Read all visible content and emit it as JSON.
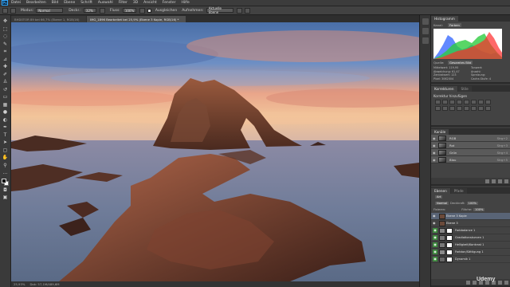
{
  "app": {
    "logo": "Ps"
  },
  "menu": [
    "Datei",
    "Bearbeiten",
    "Bild",
    "Ebene",
    "Schrift",
    "Auswahl",
    "Filter",
    "3D",
    "Ansicht",
    "Fenster",
    "Hilfe"
  ],
  "options": {
    "modus_label": "Modus:",
    "modus_value": "Normal",
    "deckr_label": "Deckr.:",
    "deckr_value": "32%",
    "fluss_label": "Fluss:",
    "fluss_value": "100%",
    "ausgleichen_label": "Ausgleichen",
    "aufnehmen_label": "Aufnehmen:",
    "aufnehmen_value": "Aktuelle Ebene"
  },
  "tabs": [
    {
      "label": "BHD0TOR 89 bei 66,7% (Ebene 1, RGB/16)",
      "active": false
    },
    {
      "label": "IMG_1896 Bearbeitet bei 25,9% (Ebene 3 Kopie, RGB/16) *",
      "active": true
    }
  ],
  "status": {
    "zoom": "25,93%",
    "doc": "Dok: 57,1M/489,6M"
  },
  "histogram": {
    "tab": "Histogramm",
    "kanal_label": "Kanal:",
    "kanal_value": "Farben",
    "quelle_label": "Quelle:",
    "quelle_value": "Gesamtes Bild",
    "stats": [
      "Mittelwert: 119,95",
      "Tonwert:",
      "Abweichung: 61,47",
      "Anzahl:",
      "Zentralwert: 123",
      "Spreizung:",
      "Pixel: 3062004",
      "Cache-Stufe: 4"
    ],
    "colors": {
      "red": "#ff2a2a",
      "green": "#2ecc40",
      "blue": "#3b6cff"
    }
  },
  "adjustments": {
    "tabs": [
      "Korrekturen",
      "Stile"
    ],
    "title": "Korrektur hinzufügen"
  },
  "channels": {
    "tab": "Kanäle",
    "rows": [
      {
        "name": "RGB",
        "key": "Strg+2"
      },
      {
        "name": "Rot",
        "key": "Strg+3"
      },
      {
        "name": "Grün",
        "key": "Strg+4"
      },
      {
        "name": "Blau",
        "key": "Strg+5"
      }
    ]
  },
  "layers": {
    "tabs": [
      "Ebenen",
      "Pfade"
    ],
    "kind_label": "Art",
    "mode_value": "Normal",
    "opacity_label": "Deckkraft:",
    "opacity_value": "100%",
    "lock_label": "Fixieren:",
    "fill_label": "Fläche:",
    "fill_value": "100%",
    "rows": [
      {
        "name": "Ebene 3 Kopie",
        "selected": true,
        "mask": false,
        "eye": false,
        "thumb": "#6b4a3a"
      },
      {
        "name": "Ebene 3",
        "selected": false,
        "mask": false,
        "eye": false,
        "thumb": "#6b4a3a"
      },
      {
        "name": "Farbbalance 1",
        "selected": false,
        "mask": true,
        "eye": true,
        "thumb": "#888888"
      },
      {
        "name": "Gradiationskurven 1",
        "selected": false,
        "mask": true,
        "eye": true,
        "thumb": "#777777"
      },
      {
        "name": "Helligkeit/Kontrast 1",
        "selected": false,
        "mask": true,
        "eye": true,
        "thumb": "#7a7a7a"
      },
      {
        "name": "Farbton/Sättigung 1",
        "selected": false,
        "mask": true,
        "eye": true,
        "thumb": "#8a8a8a"
      },
      {
        "name": "Dynamik 1",
        "selected": false,
        "mask": true,
        "eye": true,
        "thumb": "#666666"
      }
    ]
  },
  "watermark": "Udemy"
}
